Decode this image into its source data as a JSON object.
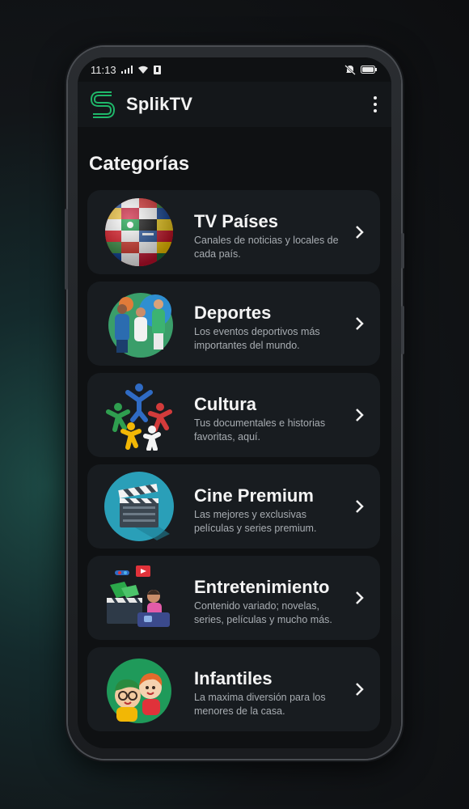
{
  "status": {
    "time": "11:13"
  },
  "app": {
    "name": "SplikTV"
  },
  "section_title": "Categorías",
  "categories": [
    {
      "title": "TV Países",
      "desc": "Canales de noticias y locales de cada país."
    },
    {
      "title": "Deportes",
      "desc": "Los eventos deportivos más importantes del mundo."
    },
    {
      "title": "Cultura",
      "desc": "Tus documentales e historias favoritas, aquí."
    },
    {
      "title": "Cine Premium",
      "desc": "Las mejores y exclusivas películas y series premium."
    },
    {
      "title": "Entretenimiento",
      "desc": "Contenido variado; novelas, series, películas y mucho más."
    },
    {
      "title": "Infantiles",
      "desc": "La maxima diversión para los menores de la casa."
    }
  ],
  "colors": {
    "brand": "#1fb86a",
    "background": "#0f1113",
    "card": "#181c20"
  }
}
